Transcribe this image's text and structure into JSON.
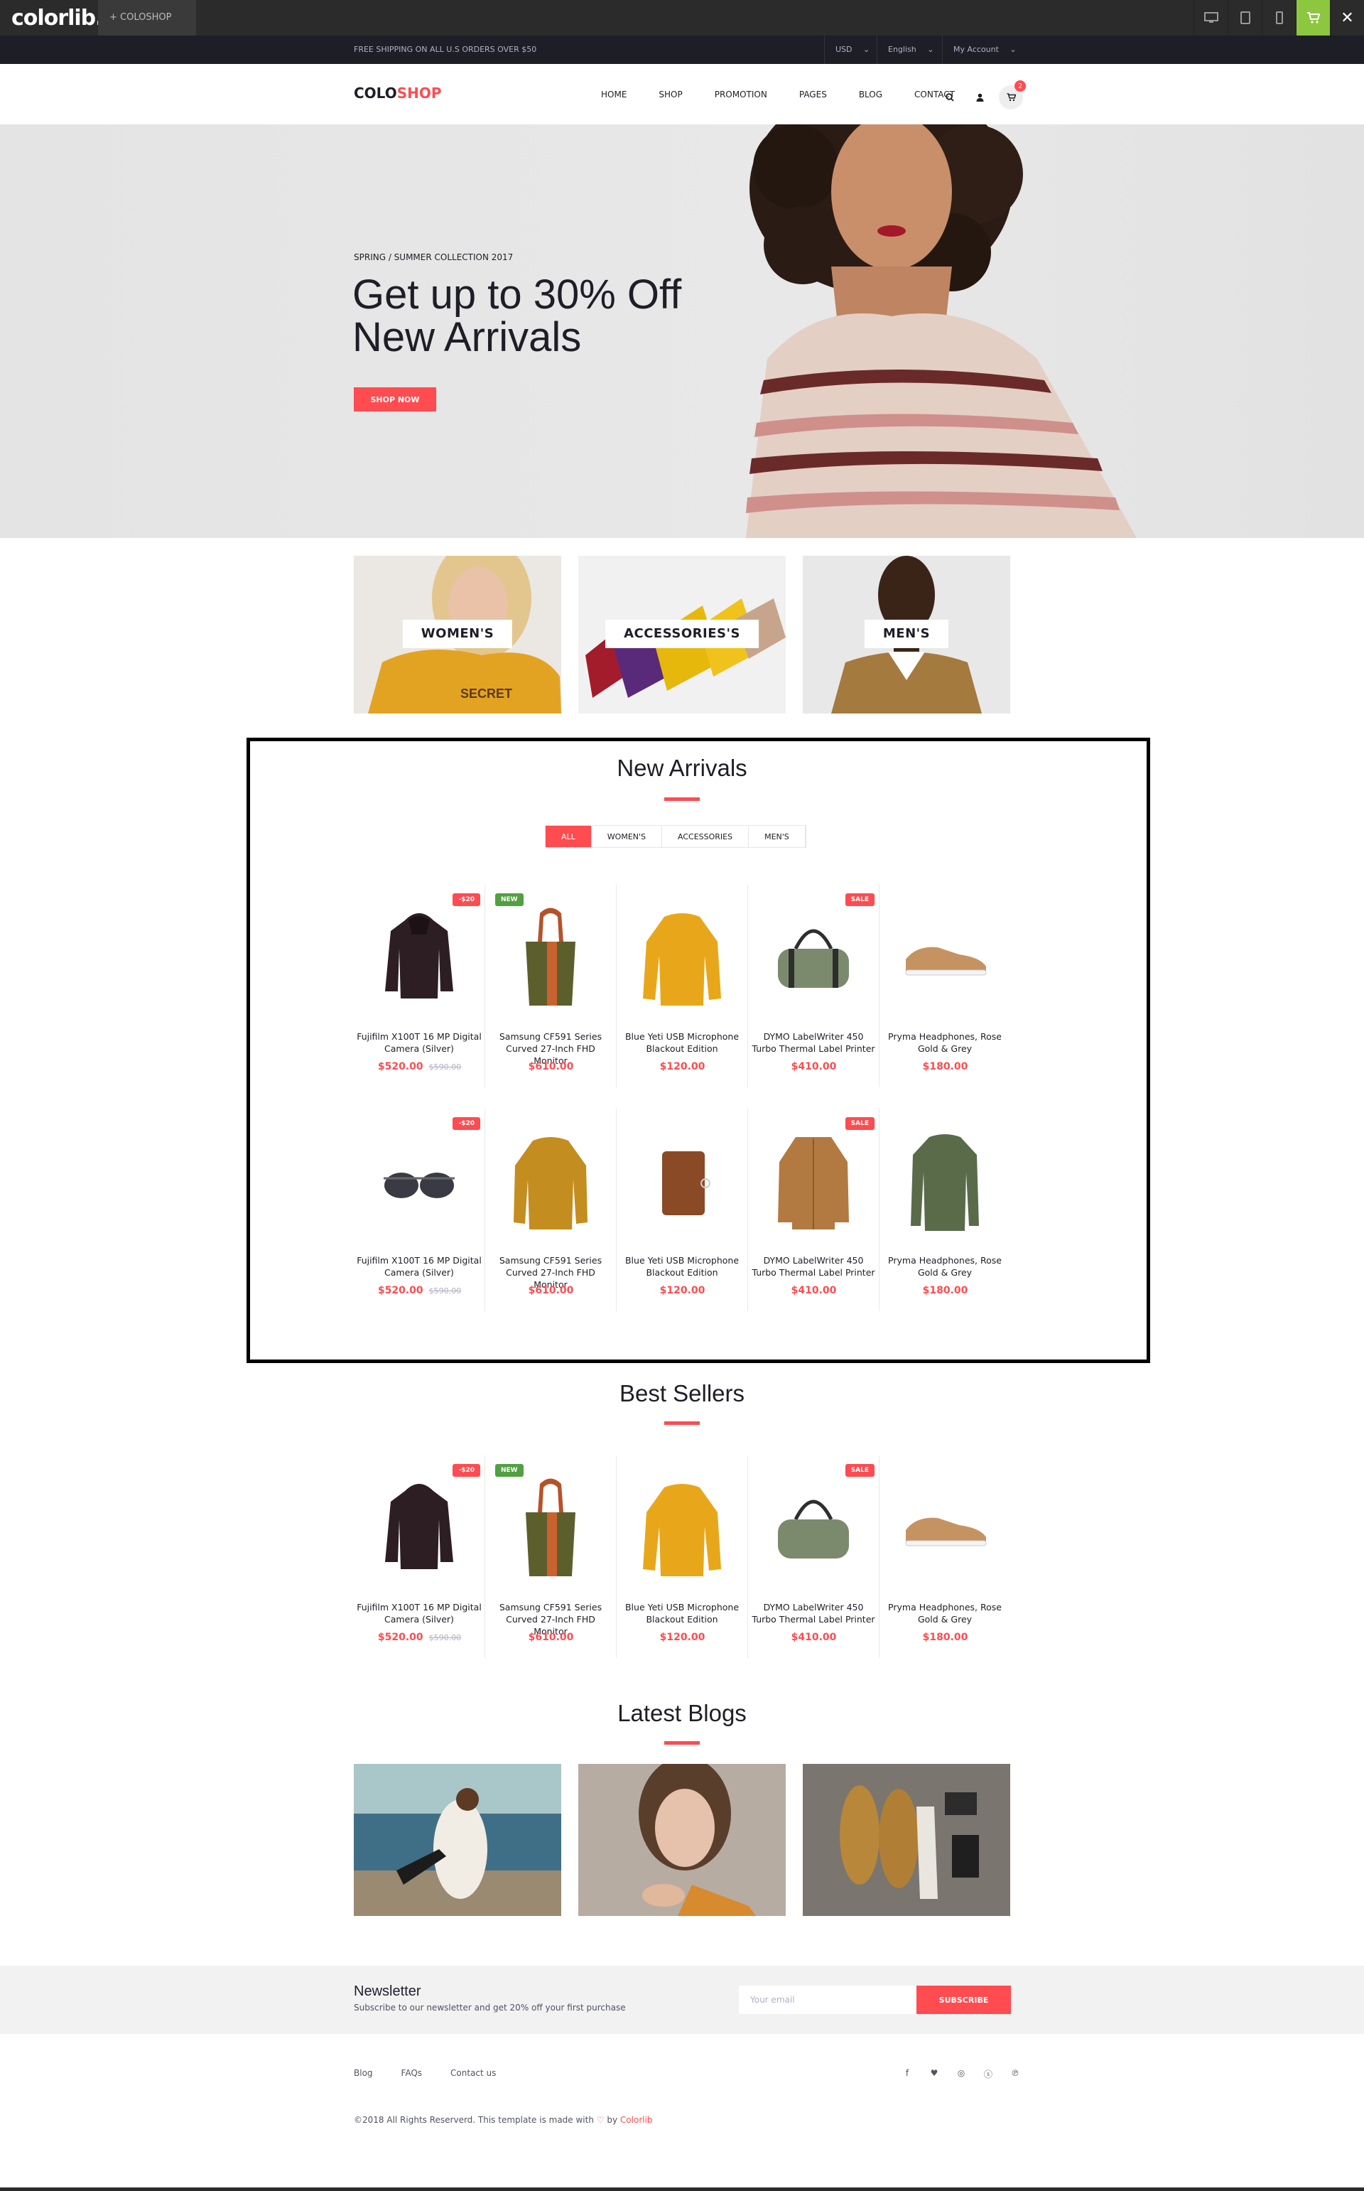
{
  "colorlib_bar": {
    "logo": "colorlib.",
    "tab": "+ COLOSHOP",
    "devices": [
      "desktop-icon",
      "tablet-icon",
      "mobile-icon",
      "cart-icon",
      "close-icon"
    ]
  },
  "topnote": {
    "shipping": "FREE SHIPPING ON ALL U.S ORDERS OVER $50",
    "currency": "USD",
    "language": "English",
    "account": "My Account"
  },
  "header": {
    "logo_a": "COLO",
    "logo_b": "SHOP",
    "nav": [
      "HOME",
      "SHOP",
      "PROMOTION",
      "PAGES",
      "BLOG",
      "CONTACT"
    ],
    "cart_count": "2"
  },
  "hero": {
    "subtitle": "SPRING / SUMMER COLLECTION 2017",
    "title_line1": "Get up to 30% Off",
    "title_line2": "New Arrivals",
    "button": "SHOP NOW"
  },
  "categories": [
    {
      "label": "WOMEN'S"
    },
    {
      "label": "ACCESSORIES'S"
    },
    {
      "label": "MEN'S"
    }
  ],
  "new_arrivals": {
    "title": "New Arrivals",
    "filters": [
      "ALL",
      "WOMEN'S",
      "ACCESSORIES",
      "MEN'S"
    ],
    "active_filter": "ALL"
  },
  "products_row1": [
    {
      "name": "Fujifilm X100T 16 MP Digital Camera (Silver)",
      "price": "$520.00",
      "old": "$590.00",
      "badge": "-$20",
      "badge_type": "red"
    },
    {
      "name": "Samsung CF591 Series Curved 27-Inch FHD Monitor",
      "price": "$610.00",
      "old": "",
      "badge": "NEW",
      "badge_type": "green"
    },
    {
      "name": "Blue Yeti USB Microphone Blackout Edition",
      "price": "$120.00",
      "old": "",
      "badge": "",
      "badge_type": ""
    },
    {
      "name": "DYMO LabelWriter 450 Turbo Thermal Label Printer",
      "price": "$410.00",
      "old": "",
      "badge": "SALE",
      "badge_type": "red"
    },
    {
      "name": "Pryma Headphones, Rose Gold & Grey",
      "price": "$180.00",
      "old": "",
      "badge": "",
      "badge_type": ""
    }
  ],
  "products_row2": [
    {
      "name": "Fujifilm X100T 16 MP Digital Camera (Silver)",
      "price": "$520.00",
      "old": "$590.00",
      "badge": "-$20",
      "badge_type": "red"
    },
    {
      "name": "Samsung CF591 Series Curved 27-Inch FHD Monitor",
      "price": "$610.00",
      "old": "",
      "badge": "",
      "badge_type": ""
    },
    {
      "name": "Blue Yeti USB Microphone Blackout Edition",
      "price": "$120.00",
      "old": "",
      "badge": "",
      "badge_type": ""
    },
    {
      "name": "DYMO LabelWriter 450 Turbo Thermal Label Printer",
      "price": "$410.00",
      "old": "",
      "badge": "SALE",
      "badge_type": "red"
    },
    {
      "name": "Pryma Headphones, Rose Gold & Grey",
      "price": "$180.00",
      "old": "",
      "badge": "",
      "badge_type": ""
    }
  ],
  "best_sellers": {
    "title": "Best Sellers",
    "products": [
      {
        "name": "Fujifilm X100T 16 MP Digital Camera (Silver)",
        "price": "$520.00",
        "old": "$590.00",
        "badge": "-$20",
        "badge_type": "red"
      },
      {
        "name": "Samsung CF591 Series Curved 27-Inch FHD Monitor",
        "price": "$610.00",
        "old": "",
        "badge": "NEW",
        "badge_type": "green"
      },
      {
        "name": "Blue Yeti USB Microphone Blackout Edition",
        "price": "$120.00",
        "old": "",
        "badge": "",
        "badge_type": ""
      },
      {
        "name": "DYMO LabelWriter 450 Turbo Thermal Label Printer",
        "price": "$410.00",
        "old": "",
        "badge": "SALE",
        "badge_type": "red"
      },
      {
        "name": "Pryma Headphones, Rose Gold & Grey",
        "price": "$180.00",
        "old": "",
        "badge": "",
        "badge_type": ""
      }
    ]
  },
  "blogs": {
    "title": "Latest Blogs"
  },
  "newsletter": {
    "title": "Newsletter",
    "subtitle": "Subscribe to our newsletter and get 20% off your first purchase",
    "placeholder": "Your email",
    "button": "SUBSCRIBE"
  },
  "footer": {
    "links": [
      "Blog",
      "FAQs",
      "Contact us"
    ],
    "social": [
      "facebook-icon",
      "twitter-icon",
      "instagram-icon",
      "skype-icon",
      "pinterest-icon"
    ],
    "copyright_a": "©2018 All Rights Reserverd. This template is made with",
    "copyright_b": "by",
    "copyright_c": "Colorlib"
  },
  "colors": {
    "accent": "#fe4c50",
    "dark": "#1e1e27",
    "green": "#51a042"
  }
}
